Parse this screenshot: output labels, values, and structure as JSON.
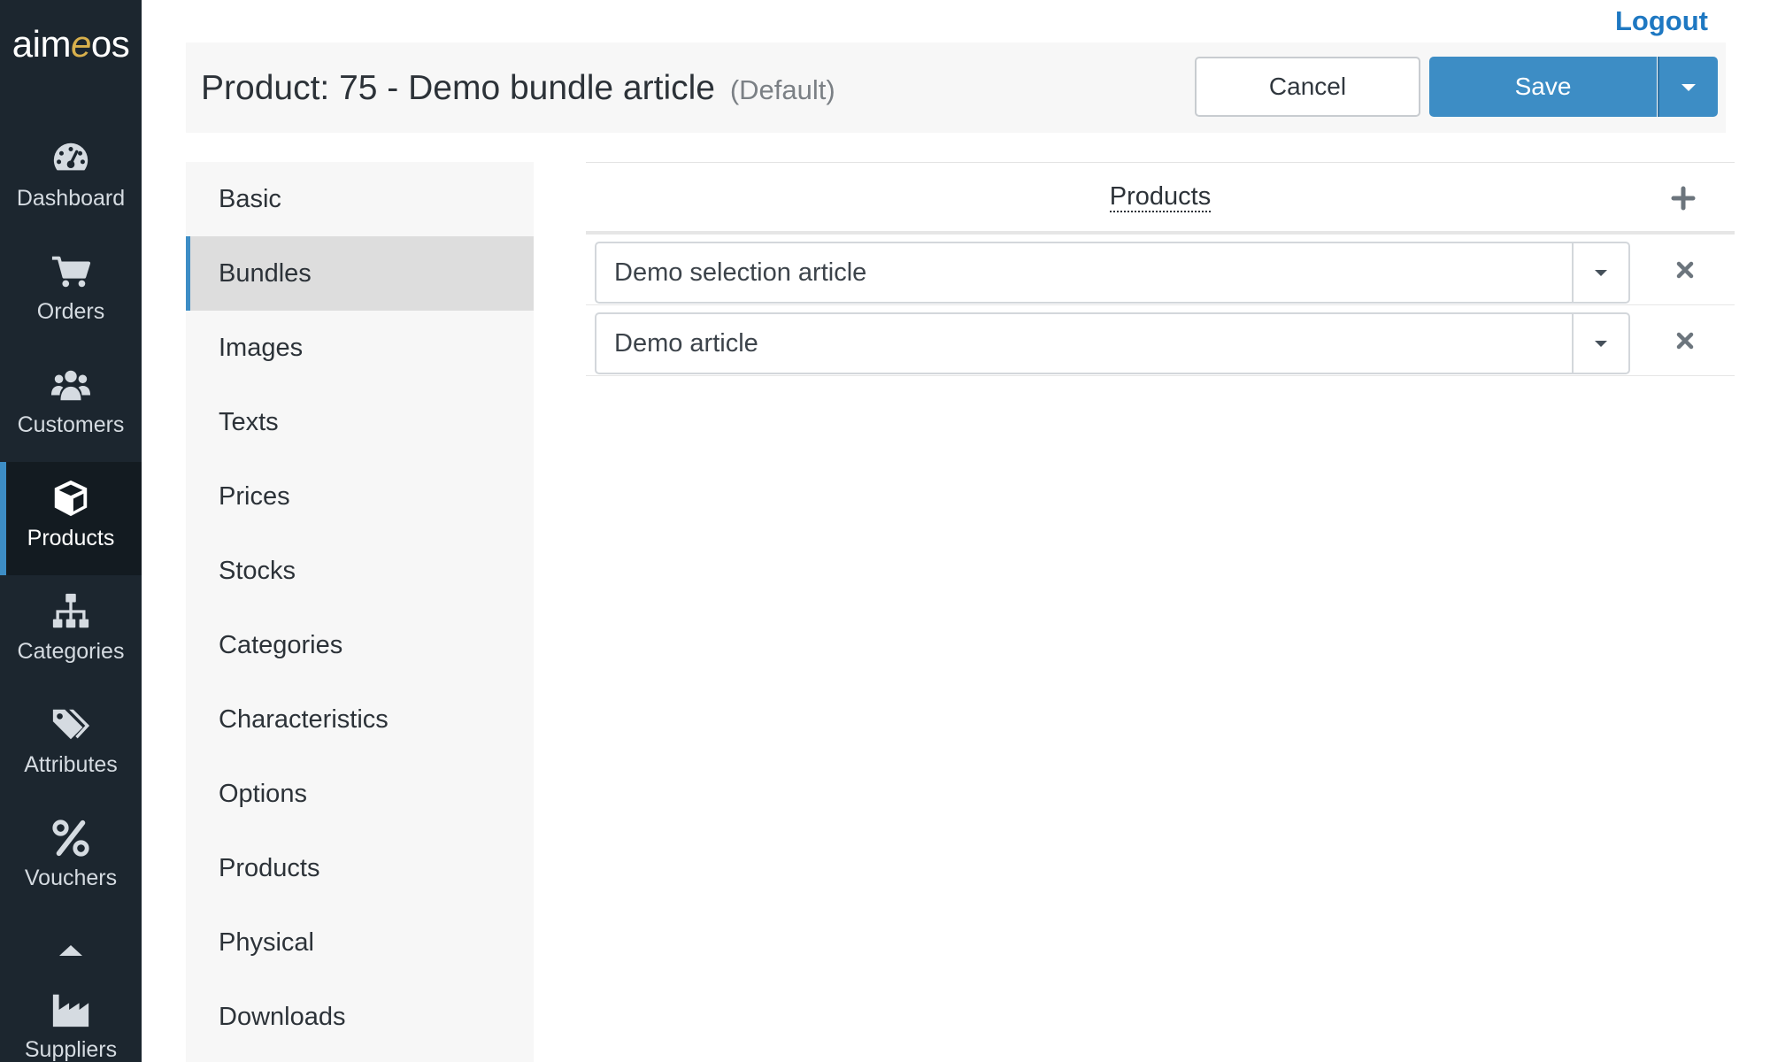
{
  "brand": {
    "logo_pre": "aim",
    "logo_e": "e",
    "logo_post": "os"
  },
  "nav": {
    "items": [
      {
        "label": "Dashboard",
        "icon": "dashboard-icon"
      },
      {
        "label": "Orders",
        "icon": "cart-icon"
      },
      {
        "label": "Customers",
        "icon": "users-icon"
      },
      {
        "label": "Products",
        "icon": "cube-icon",
        "active": true
      },
      {
        "label": "Categories",
        "icon": "sitemap-icon"
      },
      {
        "label": "Attributes",
        "icon": "tags-icon"
      },
      {
        "label": "Vouchers",
        "icon": "percent-icon"
      },
      {
        "label": "Suppliers",
        "icon": "industry-icon"
      }
    ]
  },
  "header": {
    "logout": "Logout",
    "title": "Product: 75 - Demo bundle article",
    "subtitle": "(Default)",
    "cancel": "Cancel",
    "save": "Save"
  },
  "sections": {
    "active": "Bundles",
    "items": [
      "Basic",
      "Bundles",
      "Images",
      "Texts",
      "Prices",
      "Stocks",
      "Categories",
      "Characteristics",
      "Options",
      "Products",
      "Physical",
      "Downloads"
    ]
  },
  "bundle": {
    "header": "Products",
    "rows": [
      {
        "value": "Demo selection article"
      },
      {
        "value": "Demo article"
      }
    ]
  },
  "colors": {
    "nav_bg": "#1c262f",
    "nav_active_bg": "#131b21",
    "accent": "#3d8dc5",
    "logout_link": "#1e78c2",
    "logo_e": "#d8b04c"
  }
}
